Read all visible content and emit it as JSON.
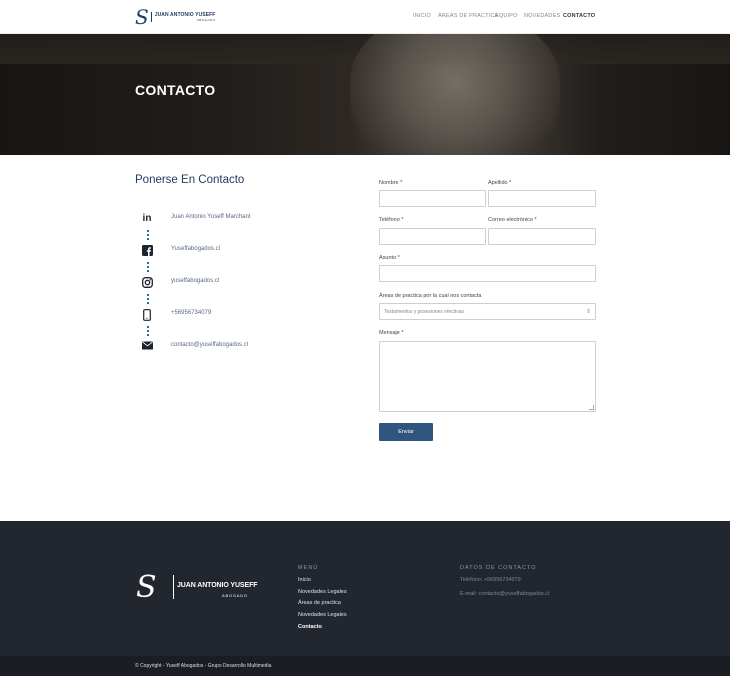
{
  "header": {
    "logo_monogram": "S",
    "logo_name": "JUAN ANTONIO YUSEFF",
    "logo_sub": "ABOGADO",
    "nav": [
      "INICIO",
      "ÁREAS DE PRACTICA",
      "EQUIPO",
      "NOVEDADES",
      "CONTACTO"
    ]
  },
  "hero": {
    "title": "CONTACTO"
  },
  "contact": {
    "title": "Ponerse En Contacto",
    "items": [
      {
        "icon": "linkedin-icon",
        "label": "Juan Antonio Yuseff Marchant"
      },
      {
        "icon": "facebook-icon",
        "label": "Yuseffabogados.cl"
      },
      {
        "icon": "instagram-icon",
        "label": "yuseffabogados.cl"
      },
      {
        "icon": "phone-icon",
        "label": "+56956734079"
      },
      {
        "icon": "mail-icon",
        "label": "contacto@yuseffabogados.cl"
      }
    ]
  },
  "form": {
    "nombre": "Nombre *",
    "apellido": "Apellido *",
    "telefono": "Teléfono *",
    "correo": "Correo electrónico *",
    "asunto": "Asunto *",
    "areas_label": "Áreas de practica por la cual nos contacta",
    "areas_value": "Testamentos y posesiones efectivas",
    "mensaje": "Mensaje *",
    "submit": "Enviar"
  },
  "footer": {
    "logo_monogram": "S",
    "logo_name": "JUAN ANTONIO YUSEFF",
    "logo_sub": "ABOGADO",
    "menu_title": "MENÚ",
    "menu": [
      "Inicio",
      "Novedades Legales",
      "Áreas de practica",
      "Novedades Legales",
      "Contacto"
    ],
    "contact_title": "DATOS DE CONTACTO",
    "phone": "Teléfono: +56956734079",
    "email": "E-mail: contacto@yuseffabogados.cl",
    "copyright": "© Copyright - Yuseff Abogados - Grupo Desarrollo Multimedia"
  },
  "colors": {
    "brand": "#1f3a5f",
    "button": "#30567d",
    "footer": "#22272f",
    "accent_dots": "#2f6f86"
  }
}
